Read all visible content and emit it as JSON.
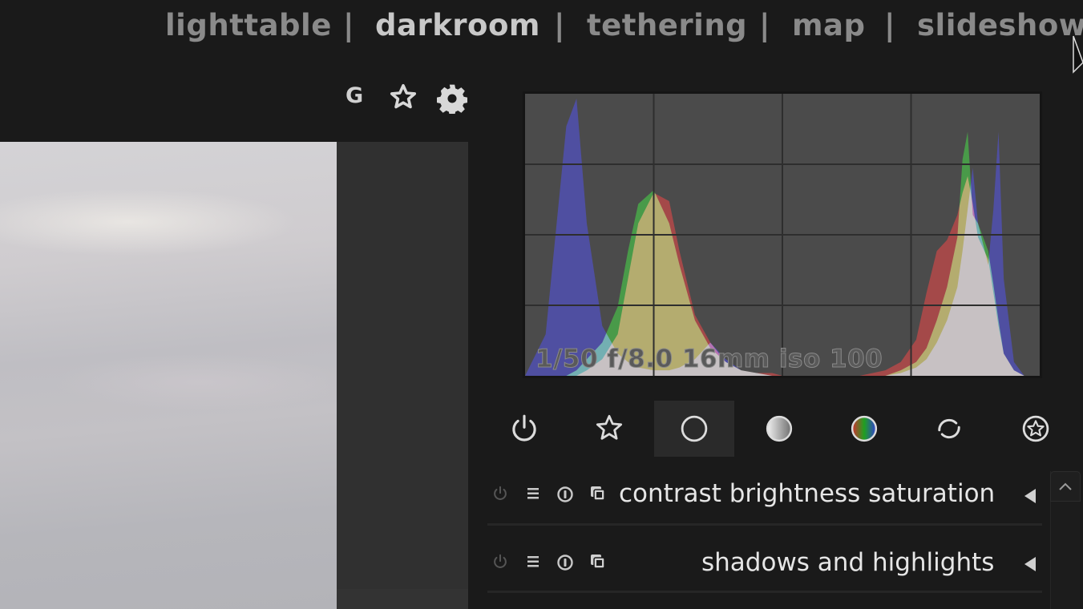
{
  "views": {
    "items": [
      {
        "label": "lighttable",
        "active": false
      },
      {
        "label": "darkroom",
        "active": true
      },
      {
        "label": "tethering",
        "active": false
      },
      {
        "label": "map",
        "active": false
      },
      {
        "label": "slideshow",
        "active": false
      }
    ],
    "separator": "|"
  },
  "center_toolbar": {
    "grouping_label": "G",
    "icons": [
      "grouping-icon",
      "star-icon",
      "gear-icon"
    ]
  },
  "histogram": {
    "exif_text": "1/50 f/8.0 16mm iso 100",
    "grid": {
      "columns": 4,
      "rows": 4
    },
    "colors": {
      "red": "#b44848",
      "green": "#48a848",
      "blue": "#5050b0",
      "background": "#4b4b4b"
    }
  },
  "chart_data": {
    "type": "area",
    "title": "",
    "xlabel": "",
    "ylabel": "",
    "x": [
      0,
      0.04,
      0.08,
      0.1,
      0.12,
      0.15,
      0.18,
      0.2,
      0.22,
      0.25,
      0.28,
      0.3,
      0.33,
      0.36,
      0.39,
      0.42,
      0.45,
      0.48,
      0.5,
      0.55,
      0.6,
      0.65,
      0.7,
      0.73,
      0.76,
      0.78,
      0.8,
      0.82,
      0.84,
      0.85,
      0.86,
      0.87,
      0.88,
      0.9,
      0.91,
      0.92,
      0.93,
      0.95,
      0.97,
      1
    ],
    "ylim": [
      0,
      1
    ],
    "grid": true,
    "series": [
      {
        "name": "red",
        "values": [
          0,
          0,
          0,
          0,
          0.02,
          0.06,
          0.15,
          0.35,
          0.55,
          0.66,
          0.63,
          0.45,
          0.22,
          0.12,
          0.05,
          0.02,
          0.01,
          0.01,
          0,
          0,
          0,
          0,
          0.02,
          0.05,
          0.13,
          0.3,
          0.45,
          0.49,
          0.58,
          0.66,
          0.72,
          0.62,
          0.5,
          0.42,
          0.3,
          0.18,
          0.08,
          0.02,
          0,
          0
        ]
      },
      {
        "name": "green",
        "values": [
          0,
          0,
          0,
          0.02,
          0.06,
          0.12,
          0.25,
          0.45,
          0.62,
          0.67,
          0.55,
          0.4,
          0.2,
          0.1,
          0.05,
          0.02,
          0.01,
          0,
          0,
          0,
          0,
          0,
          0,
          0.02,
          0.05,
          0.1,
          0.2,
          0.32,
          0.5,
          0.78,
          0.88,
          0.58,
          0.55,
          0.45,
          0.33,
          0.2,
          0.08,
          0.02,
          0,
          0
        ]
      },
      {
        "name": "blue",
        "values": [
          0,
          0.15,
          0.9,
          1.0,
          0.55,
          0.18,
          0.08,
          0.05,
          0.03,
          0.02,
          0.02,
          0.03,
          0.06,
          0.12,
          0.06,
          0.02,
          0.01,
          0,
          0,
          0,
          0,
          0,
          0,
          0.01,
          0.03,
          0.06,
          0.12,
          0.2,
          0.32,
          0.45,
          0.6,
          0.75,
          0.55,
          0.4,
          0.6,
          0.88,
          0.35,
          0.05,
          0,
          0
        ]
      }
    ]
  },
  "module_groups": [
    {
      "icon": "power-icon",
      "active": false
    },
    {
      "icon": "favorite-star-icon",
      "active": false
    },
    {
      "icon": "circle-icon",
      "active": true
    },
    {
      "icon": "tone-gradient-icon",
      "active": false
    },
    {
      "icon": "color-icon",
      "active": false
    },
    {
      "icon": "correct-icon",
      "active": false
    },
    {
      "icon": "effect-icon",
      "active": false
    }
  ],
  "modules": [
    {
      "name": "contrast brightness saturation",
      "enabled": false
    },
    {
      "name": "shadows and highlights",
      "enabled": false
    }
  ]
}
